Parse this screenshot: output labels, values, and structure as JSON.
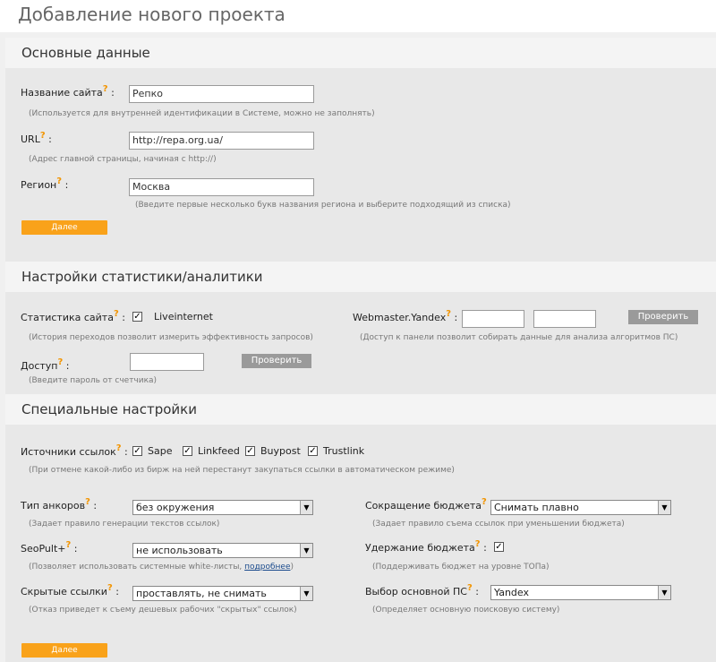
{
  "page": {
    "title": "Добавление нового проекта"
  },
  "help_mark": "?",
  "sections": {
    "basic": {
      "title": "Основные данные",
      "site_name": {
        "label": "Название сайта",
        "value": "Репко",
        "hint": "(Используется для внутренней идентификации в Системе, можно не заполнять)"
      },
      "url": {
        "label": "URL",
        "value": "http://repa.org.ua/",
        "hint": "(Адрес главной страницы, начиная с http://)"
      },
      "region": {
        "label": "Регион",
        "value": "Москва",
        "hint": "(Введите первые несколько букв названия региона и выберите подходящий из списка)"
      },
      "next_label": "Далее"
    },
    "stats": {
      "title": "Настройки статистики/аналитики",
      "site_stats": {
        "label": "Статистика сайта",
        "checkbox_label": "Liveinternet",
        "checked": true,
        "hint": "(История переходов позволит измерить эффективность запросов)"
      },
      "webmaster": {
        "label": "Webmaster.Yandex",
        "value1": "",
        "value2": "",
        "check_label": "Проверить",
        "hint": "(Доступ к панели позволит собирать данные для анализа алгоритмов ПС)"
      },
      "access": {
        "label": "Доступ",
        "value": "",
        "check_label": "Проверить",
        "hint": "(Введите пароль от счетчика)"
      }
    },
    "special": {
      "title": "Специальные настройки",
      "link_sources": {
        "label": "Источники ссылок",
        "options": [
          {
            "label": "Sape",
            "checked": true
          },
          {
            "label": "Linkfeed",
            "checked": true
          },
          {
            "label": "Buypost",
            "checked": true
          },
          {
            "label": "Trustlink",
            "checked": true
          }
        ],
        "hint": "(При отмене какой-либо из бирж на ней перестанут закупаться ссылки в автоматическом режиме)"
      },
      "anchor_type": {
        "label": "Тип анкоров",
        "value": "без окружения",
        "hint": "(Задает правило генерации текстов ссылок)"
      },
      "budget_cut": {
        "label": "Сокращение бюджета",
        "value": "Снимать плавно",
        "hint": "(Задает правило съема ссылок при уменьшении бюджета)"
      },
      "seopult": {
        "label": "SeoPult+",
        "value": "не использовать",
        "hint": "(Позволяет использовать системные white-листы, ",
        "hint_link": "подробнее",
        "hint_end": ")"
      },
      "budget_hold": {
        "label": "Удержание бюджета",
        "checked": true,
        "hint": "(Поддерживать бюджет на уровне ТОПа)"
      },
      "hidden_links": {
        "label": "Скрытые ссылки",
        "value": "проставлять, не снимать",
        "hint": "(Отказ приведет к съему дешевых рабочих \"скрытых\" ссылок)"
      },
      "main_se": {
        "label": "Выбор основной ПС",
        "value": "Yandex",
        "hint": "(Определяет основную поисковую систему)"
      },
      "next_label": "Далее"
    }
  },
  "colors": {
    "accent_orange": "#f9a21a",
    "help_orange": "#f29400",
    "gray_button": "#9a9a9a"
  }
}
